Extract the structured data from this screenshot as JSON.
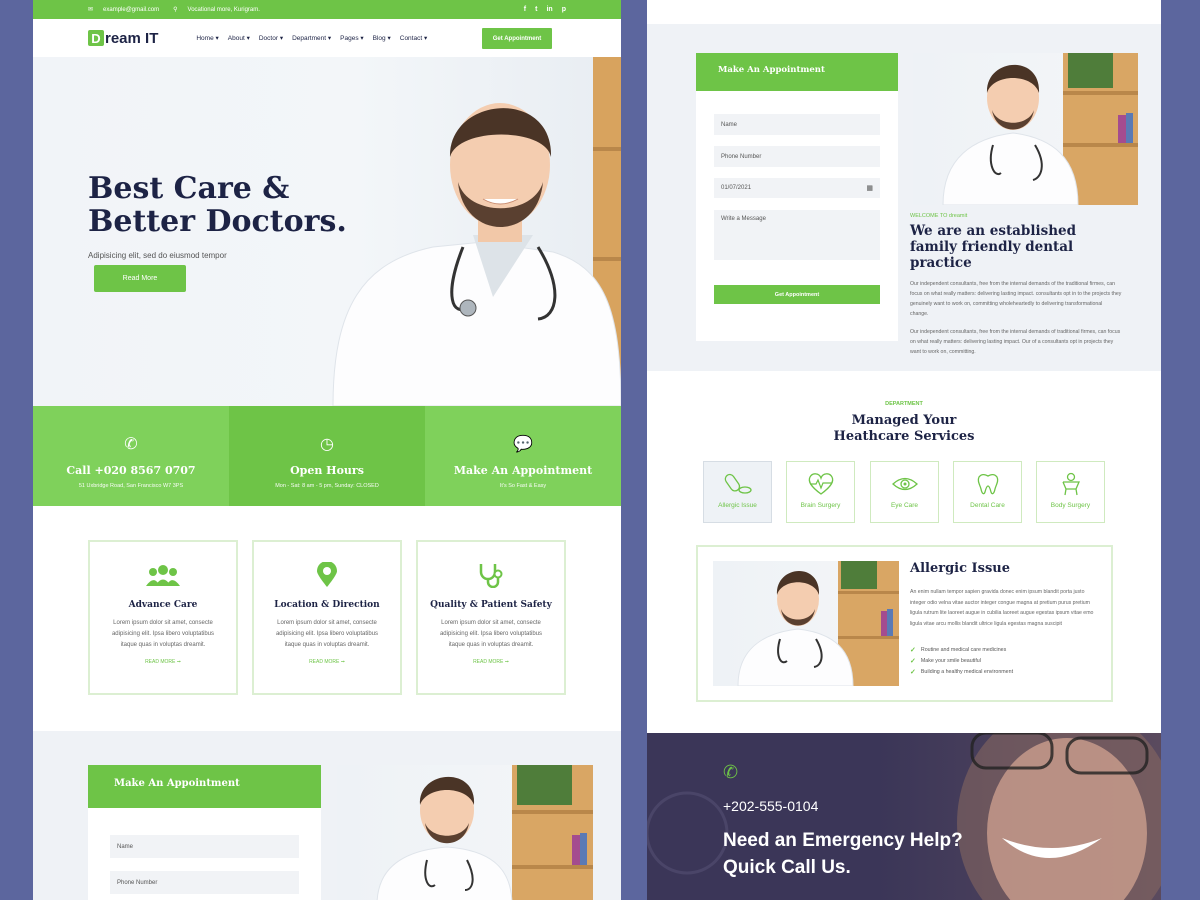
{
  "topbar": {
    "email": "example@gmail.com",
    "location": "Vocational more, Kurigram.",
    "social": [
      "f",
      "t",
      "in",
      "p"
    ]
  },
  "brand": {
    "mark": "D",
    "name": "ream IT"
  },
  "nav": {
    "items": [
      "Home",
      "About",
      "Doctor",
      "Department",
      "Pages",
      "Blog",
      "Contact"
    ],
    "cta": "Get Appointment"
  },
  "hero": {
    "title": "Best Care & Better Doctors.",
    "subtitle": "Adipisicing elit, sed do eiusmod tempor",
    "button": "Read More"
  },
  "info": [
    {
      "icon": "phone-icon",
      "title": "Call +020 8567 0707",
      "text": "51 Uxbridge Road, San Francisco W7 3PS"
    },
    {
      "icon": "clock-icon",
      "title": "Open Hours",
      "text": "Mon - Sat: 8 am - 5 pm, Sunday: CLOSED"
    },
    {
      "icon": "chat-icon",
      "title": "Make An Appointment",
      "text": "It's So Fast & Easy"
    }
  ],
  "features": [
    {
      "icon": "users-icon",
      "title": "Advance Care",
      "text": "Lorem ipsum dolor sit amet, consecte adipisicing elit. Ipsa libero voluptatibus itaque quas in voluptas dreamit.",
      "more": "READ MORE"
    },
    {
      "icon": "location-pin-icon",
      "title": "Location & Direction",
      "text": "Lorem ipsum dolor sit amet, consecte adipisicing elit. Ipsa libero voluptatibus itaque quas in voluptas dreamit.",
      "more": "READ MORE"
    },
    {
      "icon": "stethoscope-icon",
      "title": "Quality & Patient Safety",
      "text": "Lorem ipsum dolor sit amet, consecte adipisicing elit. Ipsa libero voluptatibus itaque quas in voluptas dreamit.",
      "more": "READ MORE"
    }
  ],
  "appointment": {
    "title": "Make An Appointment",
    "name_placeholder": "Name",
    "phone_placeholder": "Phone Number",
    "date_value": "01/07/2021",
    "message_placeholder": "Write a Message",
    "submit": "Get Appointment"
  },
  "welcome": {
    "tag": "WELCOME TO dreamit",
    "title": "We are an established family friendly dental practice",
    "p1": "Our independent consultants, free from the internal demands of the traditional firmes, can focus on what really matters: delivering lasting impact. consultants opt in to the projects they genuinely want to work on, committing wholeheartedly to delivering transformational change.",
    "p2": "Our independent consultants, free from the internal demands of traditional firmes, can focus on what really matters: delivering lasting impact. Our of a consultants opt in projects they want to work on, committing."
  },
  "department": {
    "tag": "DEPARTMENT",
    "title_line1": "Managed Your",
    "title_line2": "Heathcare Services",
    "items": [
      {
        "icon": "pills-icon",
        "label": "Allergic Issue"
      },
      {
        "icon": "heartbeat-icon",
        "label": "Brain Surgery"
      },
      {
        "icon": "eye-icon",
        "label": "Eye Care"
      },
      {
        "icon": "tooth-icon",
        "label": "Dental Care"
      },
      {
        "icon": "body-icon",
        "label": "Body Surgery"
      }
    ],
    "detail": {
      "title": "Allergic Issue",
      "text": "An enim nullam tempor sapien gravida donec enim ipsum blandit porta justo integer odio velna vitae auctor integer congue magna at pretium purus pretium ligula rutrum lite laoreet augue in cubilia laoreet augue egestas ipsum vitae emo ligula vitae arcu mollis blandit ultrice ligula egestas magna suscipit",
      "bullets": [
        "Routine and medical care medicines",
        "Make your smile beautiful",
        "Building a healthy medical environment"
      ]
    }
  },
  "emergency": {
    "phone": "+202-555-0104",
    "title_line1": "Need an Emergency Help?",
    "title_line2": "Quick Call Us."
  },
  "colors": {
    "accent": "#6ec447",
    "dark": "#1d2345",
    "frame": "#5c669e"
  }
}
